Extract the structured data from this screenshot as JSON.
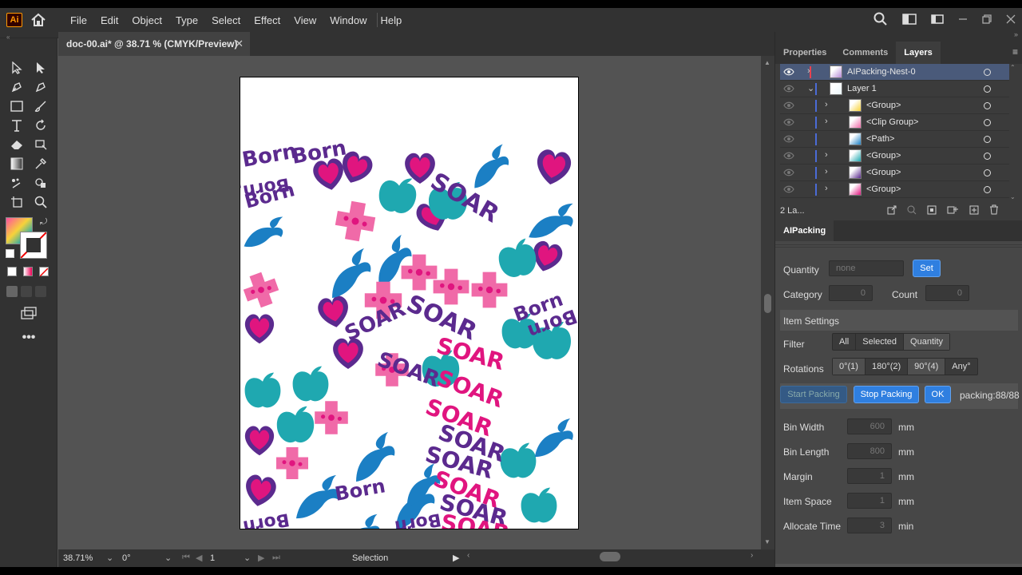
{
  "app": {
    "logo": "Ai"
  },
  "menu": [
    "File",
    "Edit",
    "Object",
    "Type",
    "Select",
    "Effect",
    "View",
    "Window",
    "Help"
  ],
  "document": {
    "tab_title": "doc-00.ai* @ 38.71 % (CMYK/Preview)",
    "close": "✕"
  },
  "status": {
    "zoom": "38.71%",
    "rotation": "0°",
    "artboard": "1",
    "tool": "Selection"
  },
  "panel_tabs": [
    "Properties",
    "Comments",
    "Layers"
  ],
  "layers": {
    "rows": [
      {
        "name": "AIPacking-Nest-0",
        "indent": 0,
        "chevron": "›"
      },
      {
        "name": "Layer 1",
        "indent": 0,
        "chevron": "⌄"
      },
      {
        "name": "<Group>",
        "indent": 1,
        "chevron": "›"
      },
      {
        "name": "<Clip Group>",
        "indent": 1,
        "chevron": "›"
      },
      {
        "name": "<Path>",
        "indent": 1,
        "chevron": ""
      },
      {
        "name": "<Group>",
        "indent": 1,
        "chevron": "›"
      },
      {
        "name": "<Group>",
        "indent": 1,
        "chevron": "›"
      },
      {
        "name": "<Group>",
        "indent": 1,
        "chevron": "›"
      }
    ],
    "footer_count": "2 La..."
  },
  "aipacking": {
    "title": "AIPacking",
    "quantity_label": "Quantity",
    "quantity_placeholder": "none",
    "set_button": "Set",
    "category_label": "Category",
    "category_value": "0",
    "count_label": "Count",
    "count_value": "0",
    "item_settings": "Item Settings",
    "filter_label": "Filter",
    "filter_options": [
      "All",
      "Selected",
      "Quantity"
    ],
    "rotations_label": "Rotations",
    "rotation_options": [
      "0°(1)",
      "180°(2)",
      "90°(4)",
      "Any°"
    ],
    "start_button": "Start Packing",
    "stop_button": "Stop Packing",
    "ok_button": "OK",
    "packing_status": "packing:88/88",
    "fields": [
      {
        "label": "Bin Width",
        "value": "600",
        "unit": "mm"
      },
      {
        "label": "Bin Length",
        "value": "800",
        "unit": "mm"
      },
      {
        "label": "Margin",
        "value": "1",
        "unit": "mm"
      },
      {
        "label": "Item Space",
        "value": "1",
        "unit": "mm"
      },
      {
        "label": "Allocate Time",
        "value": "3",
        "unit": "min"
      }
    ]
  },
  "artwork": {
    "word_soar": "SOAR",
    "word_born": "Born",
    "colors": {
      "purple": "#5b2a8e",
      "magenta": "#e0157f",
      "teal": "#1fa8b0",
      "blue": "#1b7fc4",
      "pink": "#f06aa8",
      "yellow": "#f7d23a"
    }
  }
}
